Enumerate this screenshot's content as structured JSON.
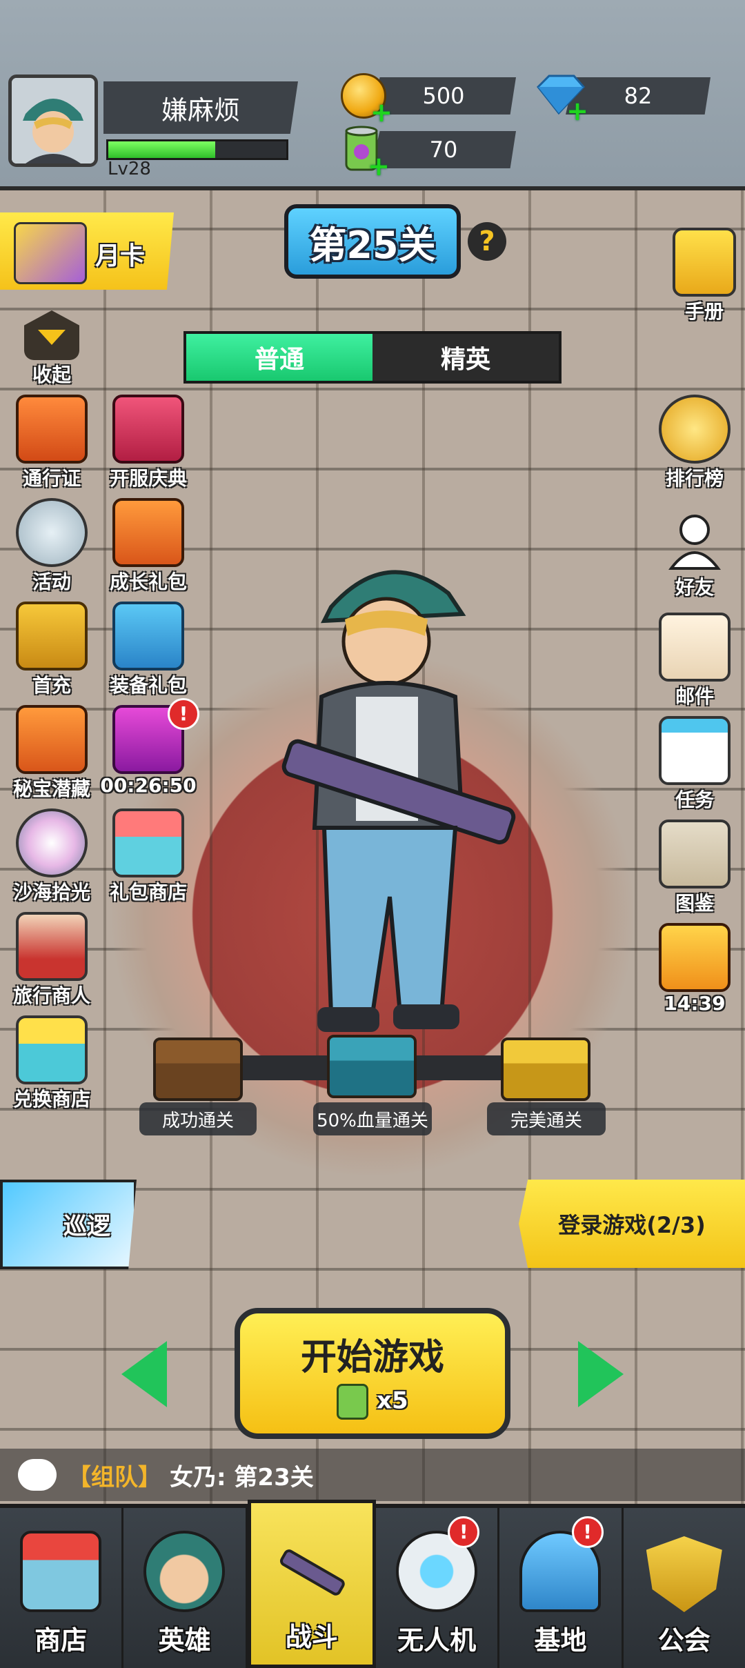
{
  "player": {
    "name": "嫌麻烦",
    "level": "Lv28",
    "xp_fraction": 0.6
  },
  "resources": {
    "gold": "500",
    "diamonds": "82",
    "energy": "70"
  },
  "stage": {
    "title": "第25关",
    "help": "?"
  },
  "difficulty_tabs": [
    {
      "label": "普通",
      "active": true
    },
    {
      "label": "精英",
      "active": false
    }
  ],
  "month_card": "月卡",
  "collapse": "收起",
  "left_menu": [
    {
      "label": "通行证"
    },
    {
      "label": "开服庆典"
    },
    {
      "label": "活动"
    },
    {
      "label": "成长礼包"
    },
    {
      "label": "首充"
    },
    {
      "label": "装备礼包"
    },
    {
      "label": "秘宝潜藏"
    },
    {
      "label": "00:26:50"
    },
    {
      "label": "沙海拾光"
    },
    {
      "label": "礼包商店"
    },
    {
      "label": "旅行商人"
    },
    {
      "label": "兑换商店"
    }
  ],
  "right_menu": [
    {
      "label": "手册"
    },
    {
      "label": "排行榜"
    },
    {
      "label": "好友"
    },
    {
      "label": "邮件"
    },
    {
      "label": "任务"
    },
    {
      "label": "图鉴"
    },
    {
      "label": "14:39"
    }
  ],
  "rewards": [
    {
      "label": "成功通关"
    },
    {
      "label": "50%血量通关"
    },
    {
      "label": "完美通关"
    }
  ],
  "patrol": "巡逻",
  "login_task": "登录游戏(2/3)",
  "start_button": {
    "label": "开始游戏",
    "cost": "x5"
  },
  "chat": {
    "tag": "【组队】",
    "message": "女乃: 第23关"
  },
  "bottom_nav": [
    {
      "label": "商店",
      "badge": ""
    },
    {
      "label": "英雄",
      "badge": ""
    },
    {
      "label": "战斗",
      "badge": ""
    },
    {
      "label": "无人机",
      "badge": "!"
    },
    {
      "label": "基地",
      "badge": "!"
    },
    {
      "label": "公会",
      "badge": ""
    }
  ],
  "colors": {
    "accent_yellow": "#f5c21a",
    "tab_green": "#19c86f",
    "stage_blue": "#2a9ddb",
    "badge_red": "#e02a2a"
  },
  "icons": {
    "avatar": "hero-portrait",
    "gold": "gold-coin-icon",
    "diamond": "blue-diamond-icon",
    "energy": "energy-can-icon"
  }
}
